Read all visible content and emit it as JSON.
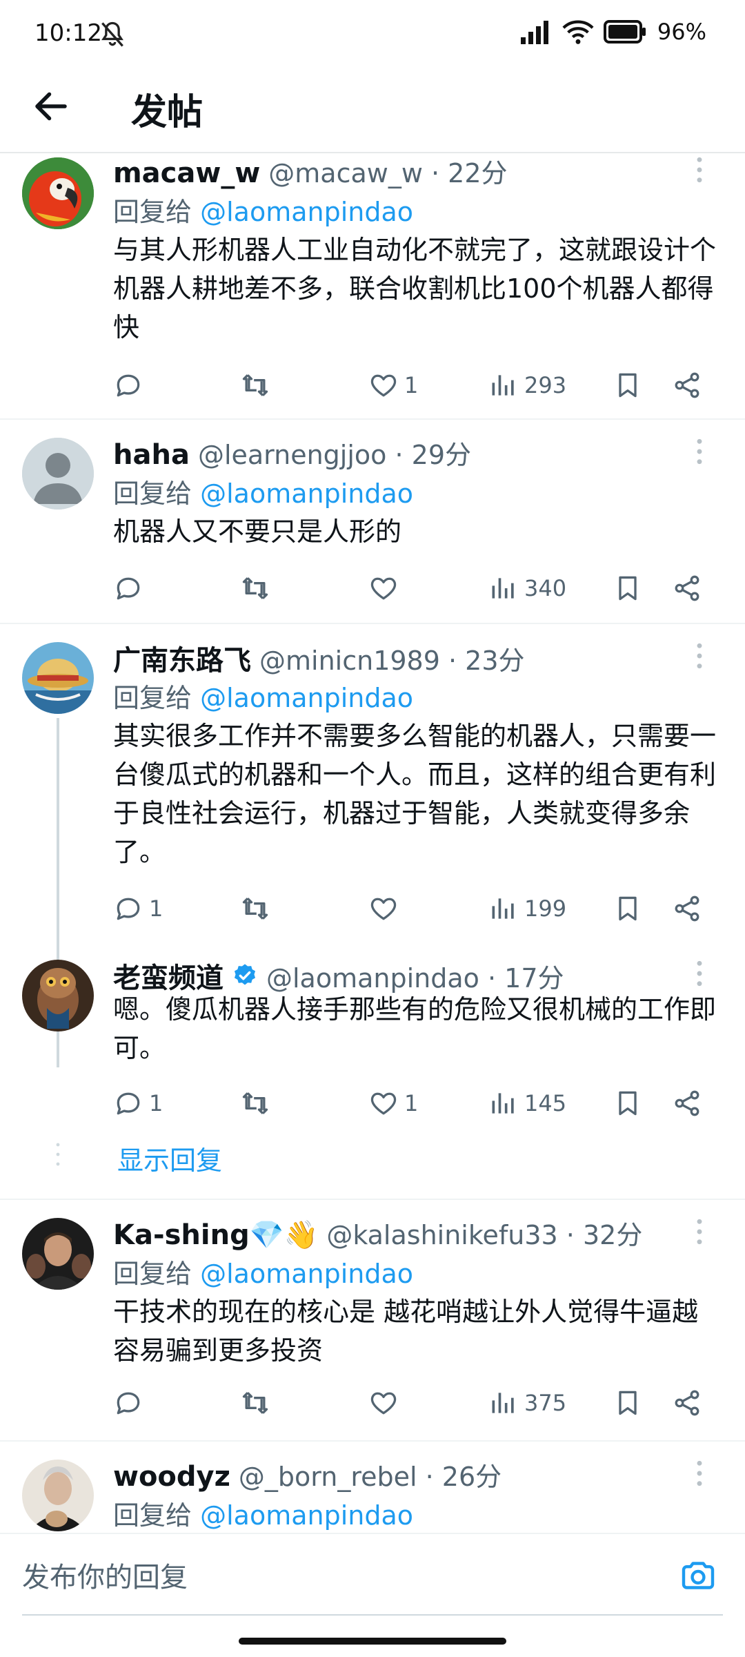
{
  "status_bar": {
    "time": "10:12",
    "battery": "96%"
  },
  "header": {
    "title": "发帖"
  },
  "actions_icons": [
    "reply-icon",
    "retweet-icon",
    "like-icon",
    "views-icon",
    "bookmark-icon",
    "share-icon"
  ],
  "posts": [
    {
      "name": "macaw_w",
      "handle": "@macaw_w",
      "time": "22分",
      "reply_label": "回复给",
      "reply_mention": "@laomanpindao",
      "text": "与其人形机器人工业自动化不就完了，这就跟设计个机器人耕地差不多，联合收割机比100个机器人都得快",
      "replies": "",
      "likes": "1",
      "views": "293"
    },
    {
      "name": "haha",
      "handle": "@learnengjjoo",
      "time": "29分",
      "reply_label": "回复给",
      "reply_mention": "@laomanpindao",
      "text": "机器人又不要只是人形的",
      "replies": "",
      "likes": "",
      "views": "340"
    },
    {
      "name": "广南东路飞",
      "handle": "@minicn1989",
      "time": "23分",
      "reply_label": "回复给",
      "reply_mention": "@laomanpindao",
      "text": "其实很多工作并不需要多么智能的机器人，只需要一台傻瓜式的机器和一个人。而且，这样的组合更有利于良性社会运行，机器过于智能，人类就变得多余了。",
      "replies": "1",
      "likes": "",
      "views": "199"
    },
    {
      "name": "老蛮频道",
      "handle": "@laomanpindao",
      "time": "17分",
      "text": "嗯。傻瓜机器人接手那些有的危险又很机械的工作即可。",
      "replies": "1",
      "likes": "1",
      "views": "145",
      "show_replies": "显示回复"
    },
    {
      "name": "Ka-shing💎👋",
      "handle": "@kalashinikefu33",
      "time": "32分",
      "reply_label": "回复给",
      "reply_mention": "@laomanpindao",
      "text": "干技术的现在的核心是 越花哨越让外人觉得牛逼越容易骗到更多投资",
      "replies": "",
      "likes": "",
      "views": "375"
    },
    {
      "name": "woodyz",
      "handle": "@_born_rebel",
      "time": "26分",
      "reply_label": "回复给",
      "reply_mention": "@laomanpindao"
    }
  ],
  "compose": {
    "placeholder": "发布你的回复"
  },
  "colors": {
    "accent": "#1d9bf0",
    "secondary_text": "#536471",
    "verified": "#1d9bf0"
  }
}
